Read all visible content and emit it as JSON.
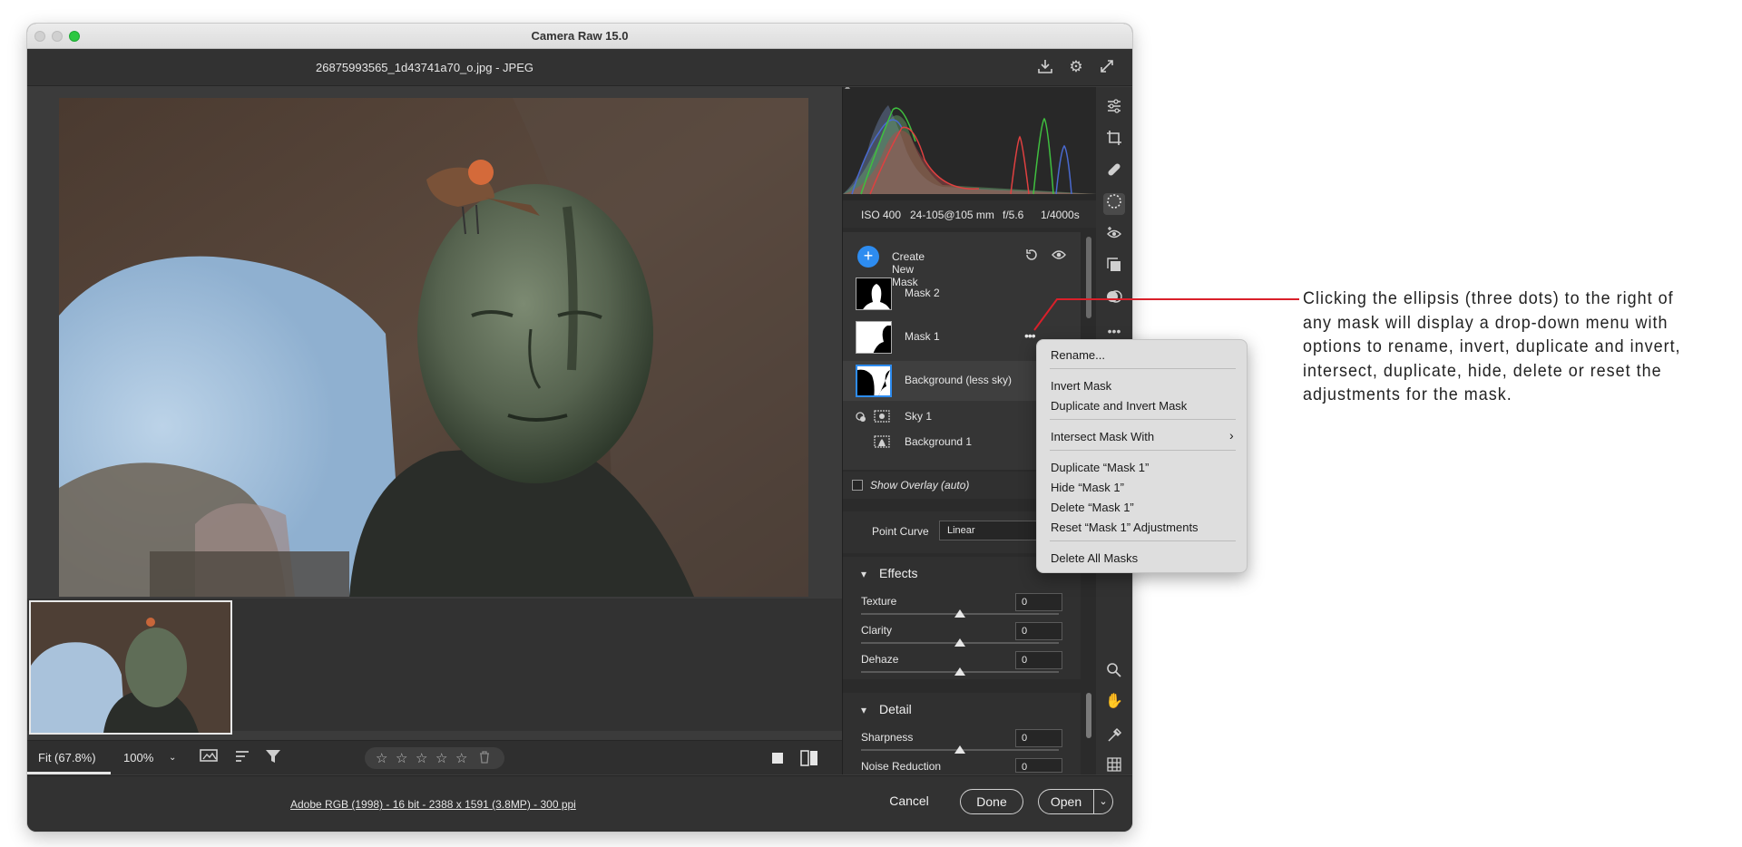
{
  "window": {
    "title": "Camera Raw 15.0",
    "file_name": "26875993565_1d43741a70_o.jpg  -  JPEG"
  },
  "header_icons": [
    "download-icon",
    "gear-icon",
    "fullscreen-icon"
  ],
  "exif": {
    "iso": "ISO 400",
    "lens": "24-105@105 mm",
    "aperture": "f/5.6",
    "shutter": "1/4000s"
  },
  "masks": {
    "create_label": "Create New Mask",
    "items": [
      {
        "label": "Mask 2"
      },
      {
        "label": "Mask 1"
      },
      {
        "label": "Background (less sky)"
      }
    ],
    "sub_items": [
      {
        "label": "Sky 1"
      },
      {
        "label": "Background 1"
      }
    ],
    "show_overlay": "Show Overlay (auto)"
  },
  "curve": {
    "label": "Point Curve",
    "value": "Linear"
  },
  "effects": {
    "title": "Effects",
    "sliders": [
      {
        "label": "Texture",
        "value": "0",
        "level": 0.5
      },
      {
        "label": "Clarity",
        "value": "0",
        "level": 0.5
      },
      {
        "label": "Dehaze",
        "value": "0",
        "level": 0.5
      }
    ]
  },
  "detail": {
    "title": "Detail",
    "sliders": [
      {
        "label": "Sharpness",
        "value": "0",
        "level": 0.5
      },
      {
        "label": "Noise Reduction",
        "value": "0",
        "level": 0.5
      }
    ]
  },
  "view_toolbar": {
    "fit": "Fit (67.8%)",
    "zoom": "100%",
    "stars": [
      "☆",
      "☆",
      "☆",
      "☆",
      "☆"
    ]
  },
  "status_bar": {
    "doc_info": "Adobe RGB (1998) - 16 bit - 2388 x 1591 (3.8MP) - 300 ppi",
    "cancel": "Cancel",
    "done": "Done",
    "open": "Open"
  },
  "context_menu": {
    "items": [
      "Rename...",
      "Invert Mask",
      "Duplicate and Invert Mask",
      "Intersect Mask With",
      "Duplicate “Mask 1”",
      "Hide “Mask 1”",
      "Delete “Mask 1”",
      "Reset “Mask 1” Adjustments",
      "Delete All Masks"
    ]
  },
  "annotation": {
    "text": "Clicking the ellipsis (three dots) to the right of any mask will display a drop-down menu with options to rename, invert, duplicate and invert, intersect, duplicate, hide, delete or reset the adjustments for the mask."
  },
  "colors": {
    "accent": "#2d8cf0",
    "callout": "#d9202a",
    "panel": "#2b2b2b"
  }
}
